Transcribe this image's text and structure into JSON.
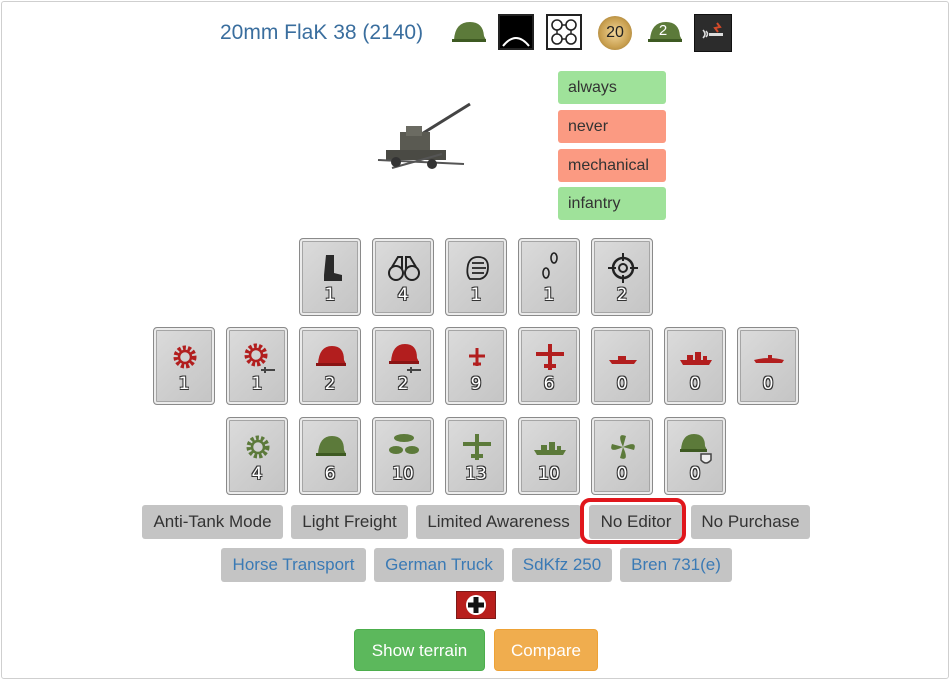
{
  "header": {
    "title": "20mm FlaK 38 (2140)",
    "icons": [
      {
        "name": "helmet-green-icon"
      },
      {
        "name": "black-arc-icon"
      },
      {
        "name": "four-circles-icon"
      },
      {
        "name": "gold-badge-icon",
        "value": "20"
      },
      {
        "name": "helmet-count-icon",
        "value": "2"
      },
      {
        "name": "fire-signal-icon"
      }
    ]
  },
  "tags": [
    {
      "label": "always",
      "color": "#9fe29a"
    },
    {
      "label": "never",
      "color": "#fb9a82"
    },
    {
      "label": "mechanical",
      "color": "#fb9a82"
    },
    {
      "label": "infantry",
      "color": "#9fe29a"
    }
  ],
  "stats": {
    "row1": [
      {
        "icon": "boot-icon",
        "value": "1"
      },
      {
        "icon": "binoculars-icon",
        "value": "4"
      },
      {
        "icon": "fist-icon",
        "value": "1"
      },
      {
        "icon": "footsteps-icon",
        "value": "1"
      },
      {
        "icon": "crosshair-icon",
        "value": "2"
      }
    ],
    "row2": [
      {
        "icon": "gear-red-icon",
        "value": "1"
      },
      {
        "icon": "gear-red-sword-icon",
        "value": "1"
      },
      {
        "icon": "helmet-red-icon",
        "value": "2"
      },
      {
        "icon": "helmet-red-sword-icon",
        "value": "2"
      },
      {
        "icon": "plane-red-small-icon",
        "value": "9"
      },
      {
        "icon": "plane-red-large-icon",
        "value": "6"
      },
      {
        "icon": "ship-red-small-icon",
        "value": "0"
      },
      {
        "icon": "ship-red-large-icon",
        "value": "0"
      },
      {
        "icon": "submarine-red-icon",
        "value": "0"
      }
    ],
    "row3": [
      {
        "icon": "gear-green-icon",
        "value": "4"
      },
      {
        "icon": "helmet-green-icon",
        "value": "6"
      },
      {
        "icon": "bombs-green-icon",
        "value": "10"
      },
      {
        "icon": "plane-green-icon",
        "value": "13"
      },
      {
        "icon": "ship-green-icon",
        "value": "10"
      },
      {
        "icon": "propeller-green-icon",
        "value": "0"
      },
      {
        "icon": "helmet-shield-green-icon",
        "value": "0"
      }
    ]
  },
  "traits": [
    "Anti-Tank Mode",
    "Light Freight",
    "Limited Awareness",
    "No Editor",
    "No Purchase"
  ],
  "transports": [
    "Horse Transport",
    "German Truck",
    "SdKfz 250",
    "Bren 731(e)"
  ],
  "nation_flag": "german-cross-flag-icon",
  "actions": {
    "show_terrain": "Show terrain",
    "compare": "Compare"
  },
  "colors": {
    "red_icon": "#b21e1e",
    "green_icon": "#5c7a3a",
    "link": "#3a7ab5",
    "highlight": "#e0161c"
  }
}
